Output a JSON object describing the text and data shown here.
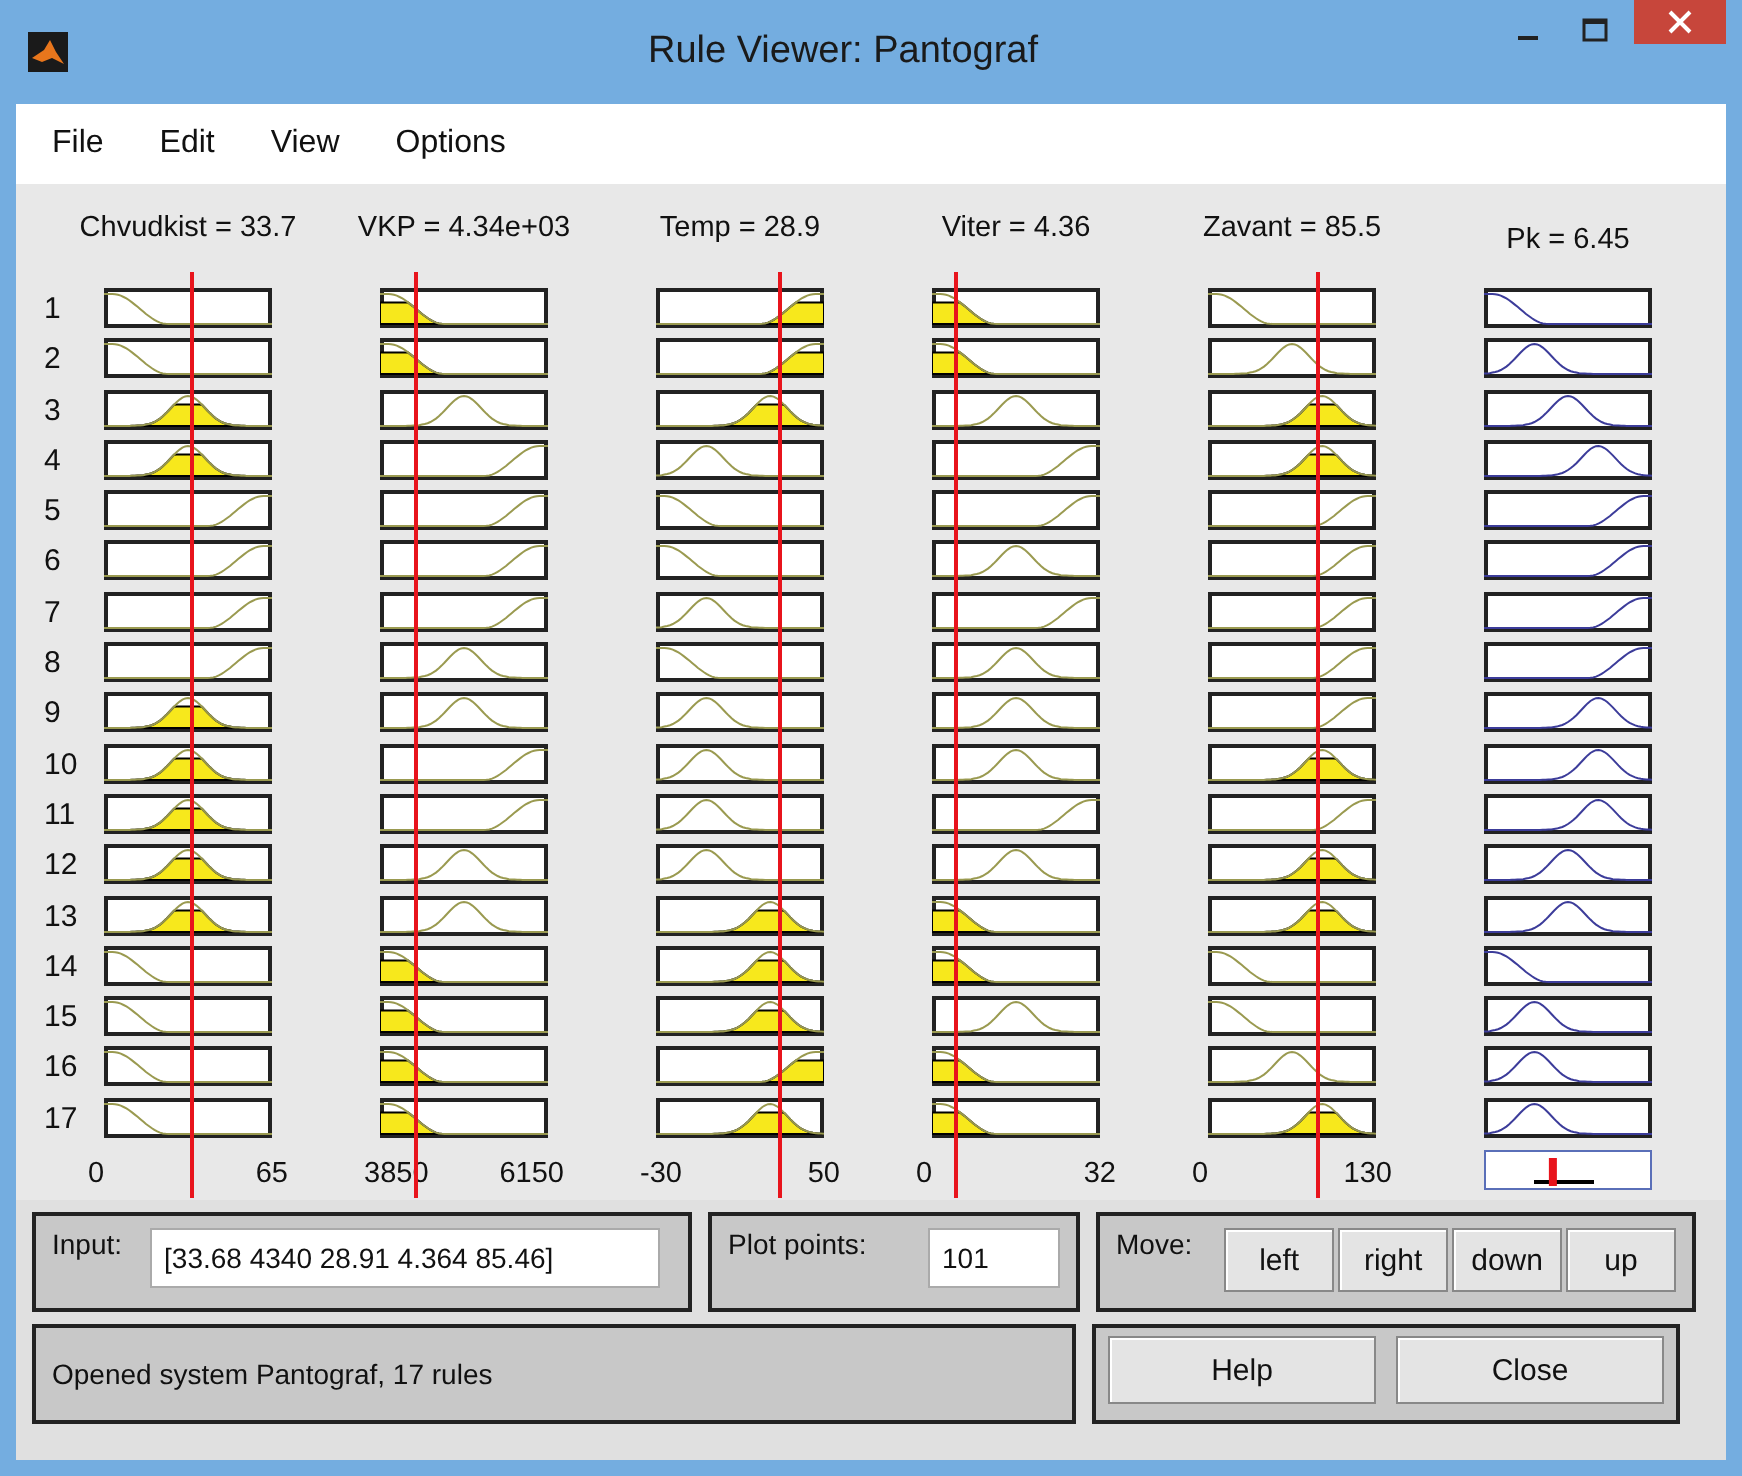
{
  "window": {
    "title": "Rule Viewer: Pantograf"
  },
  "menu": [
    "File",
    "Edit",
    "View",
    "Options"
  ],
  "rules": [
    "1",
    "2",
    "3",
    "4",
    "5",
    "6",
    "7",
    "8",
    "9",
    "10",
    "11",
    "12",
    "13",
    "14",
    "15",
    "16",
    "17"
  ],
  "inputs": [
    {
      "label": "Chvudkist = 33.7",
      "range_min": "0",
      "range_max": "65",
      "cells": [
        {
          "kind": "low",
          "fired": false
        },
        {
          "kind": "low",
          "fired": false
        },
        {
          "kind": "mid",
          "fired": true
        },
        {
          "kind": "mid",
          "fired": true
        },
        {
          "kind": "high",
          "fired": false
        },
        {
          "kind": "high",
          "fired": false
        },
        {
          "kind": "high",
          "fired": false
        },
        {
          "kind": "high",
          "fired": false
        },
        {
          "kind": "mid",
          "fired": true
        },
        {
          "kind": "mid",
          "fired": true
        },
        {
          "kind": "mid",
          "fired": true
        },
        {
          "kind": "mid",
          "fired": true
        },
        {
          "kind": "mid",
          "fired": true
        },
        {
          "kind": "low",
          "fired": false
        },
        {
          "kind": "low",
          "fired": false
        },
        {
          "kind": "low",
          "fired": false
        },
        {
          "kind": "low",
          "fired": false
        }
      ]
    },
    {
      "label": "VKP = 4.34e+03",
      "range_min": "3850",
      "range_max": "6150",
      "cells": [
        {
          "kind": "low",
          "fired": true
        },
        {
          "kind": "low",
          "fired": true
        },
        {
          "kind": "mid",
          "fired": false
        },
        {
          "kind": "high",
          "fired": false
        },
        {
          "kind": "high",
          "fired": false
        },
        {
          "kind": "high",
          "fired": false
        },
        {
          "kind": "high",
          "fired": false
        },
        {
          "kind": "mid",
          "fired": false
        },
        {
          "kind": "mid",
          "fired": false
        },
        {
          "kind": "high",
          "fired": false
        },
        {
          "kind": "high",
          "fired": false
        },
        {
          "kind": "mid",
          "fired": false
        },
        {
          "kind": "mid",
          "fired": false
        },
        {
          "kind": "low",
          "fired": true
        },
        {
          "kind": "low",
          "fired": true
        },
        {
          "kind": "low",
          "fired": true
        },
        {
          "kind": "low",
          "fired": true
        }
      ]
    },
    {
      "label": "Temp = 28.9",
      "range_min": "-30",
      "range_max": "50",
      "cells": [
        {
          "kind": "high",
          "fired": true
        },
        {
          "kind": "high",
          "fired": true
        },
        {
          "kind": "right",
          "fired": true
        },
        {
          "kind": "left",
          "fired": false
        },
        {
          "kind": "low",
          "fired": false
        },
        {
          "kind": "low",
          "fired": false
        },
        {
          "kind": "left",
          "fired": false
        },
        {
          "kind": "low",
          "fired": false
        },
        {
          "kind": "left",
          "fired": false
        },
        {
          "kind": "left",
          "fired": false
        },
        {
          "kind": "left",
          "fired": false
        },
        {
          "kind": "left",
          "fired": false
        },
        {
          "kind": "right",
          "fired": true
        },
        {
          "kind": "right",
          "fired": true
        },
        {
          "kind": "right",
          "fired": true
        },
        {
          "kind": "high",
          "fired": true
        },
        {
          "kind": "right",
          "fired": true
        }
      ]
    },
    {
      "label": "Viter = 4.36",
      "range_min": "0",
      "range_max": "32",
      "cells": [
        {
          "kind": "low",
          "fired": true
        },
        {
          "kind": "low",
          "fired": true
        },
        {
          "kind": "mid",
          "fired": false
        },
        {
          "kind": "high",
          "fired": false
        },
        {
          "kind": "high",
          "fired": false
        },
        {
          "kind": "mid",
          "fired": false
        },
        {
          "kind": "high",
          "fired": false
        },
        {
          "kind": "mid",
          "fired": false
        },
        {
          "kind": "mid",
          "fired": false
        },
        {
          "kind": "mid",
          "fired": false
        },
        {
          "kind": "high",
          "fired": false
        },
        {
          "kind": "mid",
          "fired": false
        },
        {
          "kind": "low",
          "fired": true
        },
        {
          "kind": "low",
          "fired": true
        },
        {
          "kind": "mid",
          "fired": false
        },
        {
          "kind": "low",
          "fired": true
        },
        {
          "kind": "low",
          "fired": true
        }
      ]
    },
    {
      "label": "Zavant = 85.5",
      "range_min": "0",
      "range_max": "130",
      "cells": [
        {
          "kind": "low",
          "fired": false
        },
        {
          "kind": "mid",
          "fired": false
        },
        {
          "kind": "right",
          "fired": true
        },
        {
          "kind": "right",
          "fired": true
        },
        {
          "kind": "high",
          "fired": false
        },
        {
          "kind": "high",
          "fired": false
        },
        {
          "kind": "high",
          "fired": false
        },
        {
          "kind": "high",
          "fired": false
        },
        {
          "kind": "high",
          "fired": false
        },
        {
          "kind": "right",
          "fired": true
        },
        {
          "kind": "high",
          "fired": false
        },
        {
          "kind": "right",
          "fired": true
        },
        {
          "kind": "right",
          "fired": true
        },
        {
          "kind": "low",
          "fired": false
        },
        {
          "kind": "low",
          "fired": false
        },
        {
          "kind": "mid",
          "fired": false
        },
        {
          "kind": "right",
          "fired": true
        }
      ]
    }
  ],
  "output": {
    "label": "Pk = 6.45",
    "level": 0.41,
    "cells": [
      {
        "kind": "low"
      },
      {
        "kind": "left"
      },
      {
        "kind": "mid"
      },
      {
        "kind": "right"
      },
      {
        "kind": "high"
      },
      {
        "kind": "high"
      },
      {
        "kind": "high"
      },
      {
        "kind": "high"
      },
      {
        "kind": "right"
      },
      {
        "kind": "right"
      },
      {
        "kind": "right"
      },
      {
        "kind": "mid"
      },
      {
        "kind": "mid"
      },
      {
        "kind": "low"
      },
      {
        "kind": "left"
      },
      {
        "kind": "left"
      },
      {
        "kind": "left"
      }
    ]
  },
  "input": {
    "label": "Input:",
    "value": "[33.68 4340 28.91 4.364 85.46]"
  },
  "plot_points": {
    "label": "Plot points:",
    "value": "101"
  },
  "move": {
    "label": "Move:",
    "buttons": [
      "left",
      "right",
      "down",
      "up"
    ]
  },
  "status": "Opened system Pantograf, 17 rules",
  "buttons": [
    "Help",
    "Close"
  ]
}
